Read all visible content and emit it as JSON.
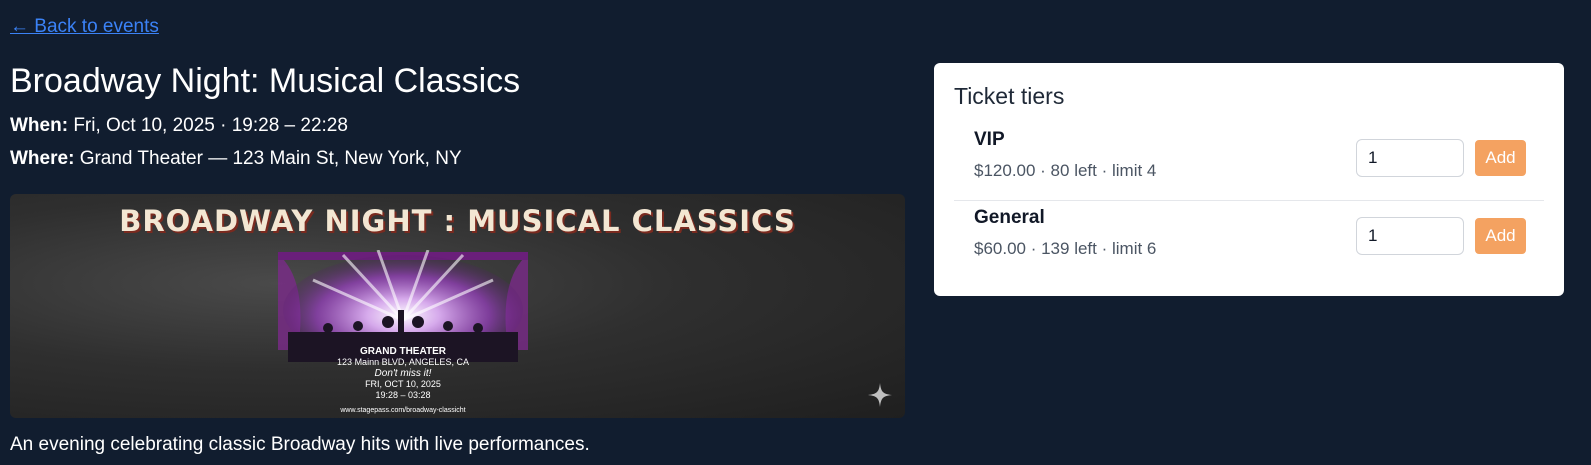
{
  "nav": {
    "back_label": "← Back to events"
  },
  "event": {
    "title": "Broadway Night: Musical Classics",
    "when_label": "When:",
    "when_value": "Fri, Oct 10, 2025 · 19:28 – 22:28",
    "where_label": "Where:",
    "where_value": "Grand Theater — 123 Main St, New York, NY",
    "description": "An evening celebrating classic Broadway hits with live performances."
  },
  "banner": {
    "headline": "BROADWAY NIGHT : MUSICAL CLASSICS",
    "venue": "GRAND THEATER",
    "address": "123 Mainn BLVD, ANGELES, CA",
    "tagline": "Don't miss it!",
    "date": "FRI, OCT 10, 2025",
    "time": "19:28 – 03:28",
    "url": "www.stagepass.com/broadway-classicht"
  },
  "tickets": {
    "heading": "Ticket tiers",
    "tiers": [
      {
        "name": "VIP",
        "detail": "$120.00 · 80 left · limit 4",
        "quantity": "1",
        "add_label": "Add"
      },
      {
        "name": "General",
        "detail": "$60.00 · 139 left · limit 6",
        "quantity": "1",
        "add_label": "Add"
      }
    ]
  },
  "colors": {
    "page_background": "#111d2f",
    "link": "#3b82f6",
    "add_button": "#f4a261",
    "card": "#ffffff"
  }
}
